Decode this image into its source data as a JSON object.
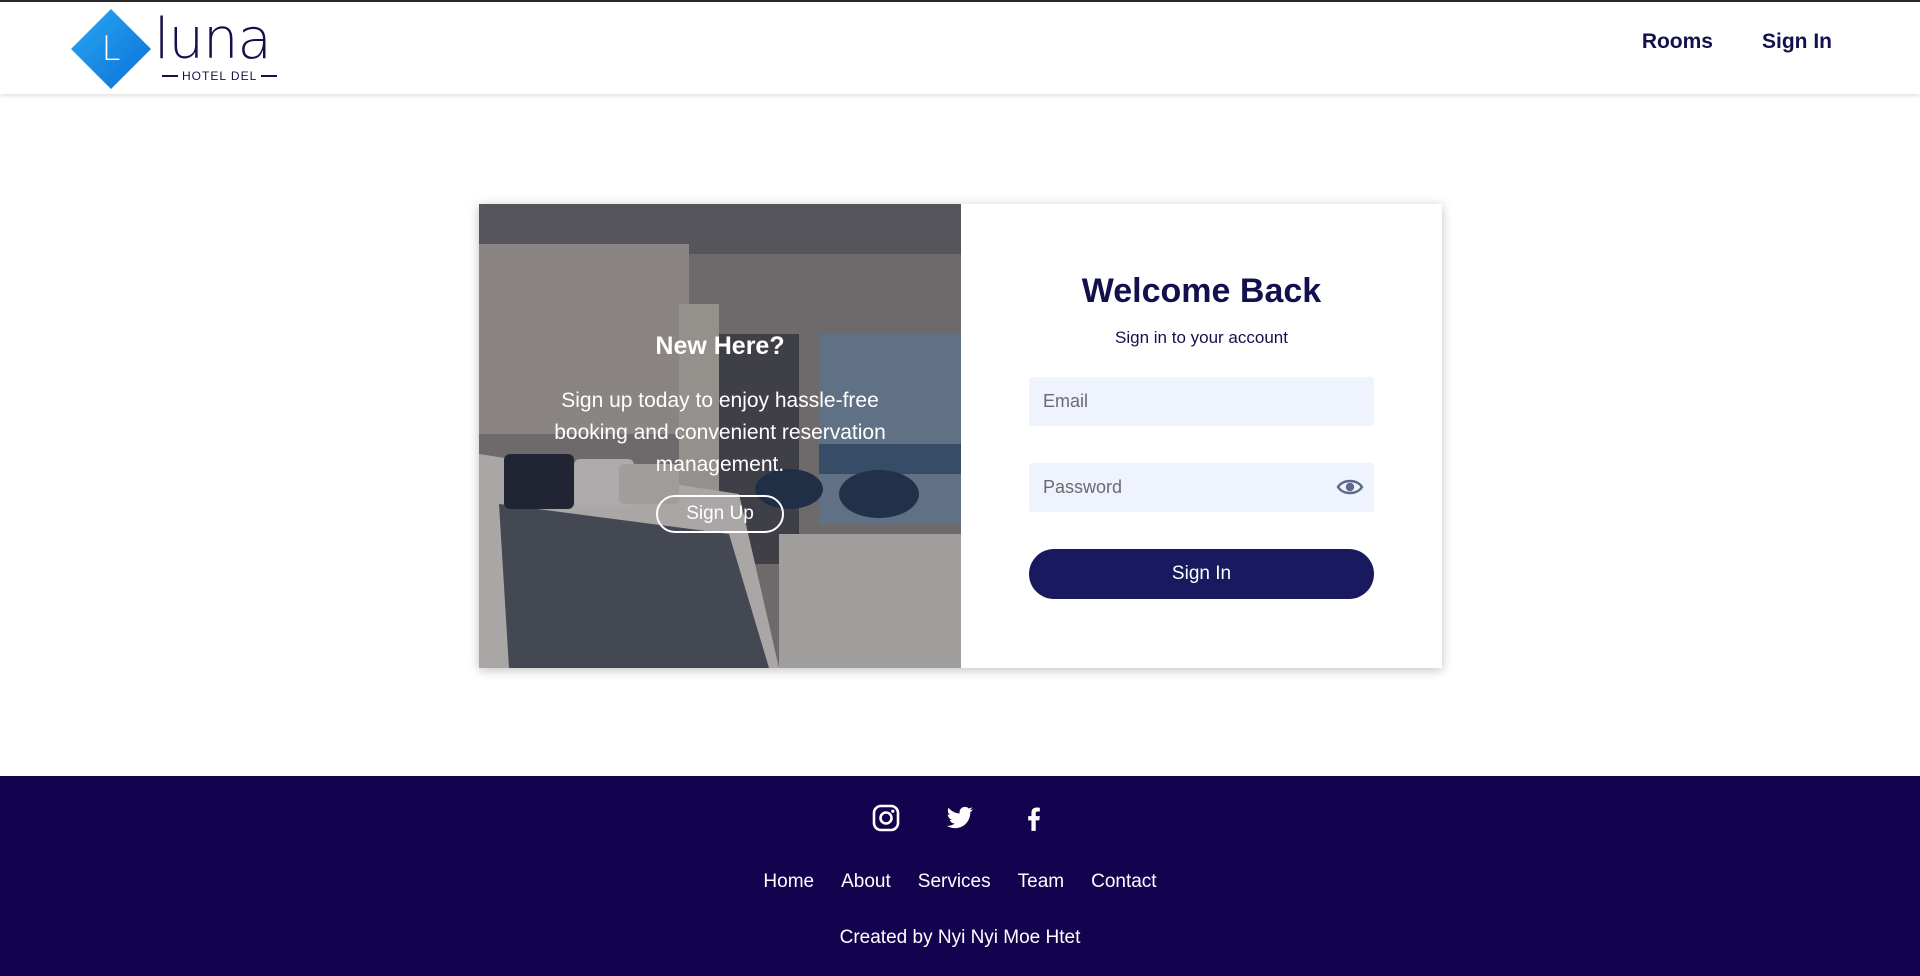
{
  "brand": {
    "logo_letter": "L",
    "name": "luna",
    "tagline": "HOTEL DEL",
    "accent_color": "#1b8be8"
  },
  "nav": {
    "items": [
      {
        "label": "Rooms"
      },
      {
        "label": "Sign In"
      }
    ]
  },
  "promo": {
    "title": "New Here?",
    "text": "Sign up today to enjoy hassle-free booking and convenient reservation management.",
    "button_label": "Sign Up"
  },
  "login": {
    "title": "Welcome Back",
    "subtitle": "Sign in to your account",
    "email_placeholder": "Email",
    "password_placeholder": "Password",
    "submit_label": "Sign In",
    "button_color": "#18195e"
  },
  "footer": {
    "social": [
      "instagram-icon",
      "twitter-icon",
      "facebook-icon"
    ],
    "links": [
      {
        "label": "Home"
      },
      {
        "label": "About"
      },
      {
        "label": "Services"
      },
      {
        "label": "Team"
      },
      {
        "label": "Contact"
      }
    ],
    "credit": "Created by Nyi Nyi Moe Htet",
    "background_color": "#13034f"
  }
}
